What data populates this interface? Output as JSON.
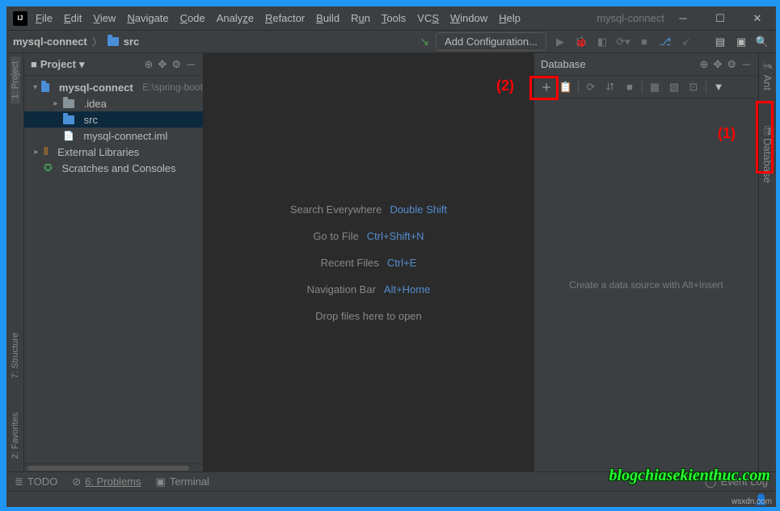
{
  "title": "mysql-connect",
  "menu": [
    "File",
    "Edit",
    "View",
    "Navigate",
    "Code",
    "Analyze",
    "Refactor",
    "Build",
    "Run",
    "Tools",
    "VCS",
    "Window",
    "Help"
  ],
  "breadcrumb": {
    "root": "mysql-connect",
    "child": "src"
  },
  "addConfig": "Add Configuration...",
  "projectPanel": {
    "title": "Project",
    "tree": {
      "root": "mysql-connect",
      "rootPath": "E:\\spring-boot",
      "idea": ".idea",
      "src": "src",
      "iml": "mysql-connect.iml",
      "libs": "External Libraries",
      "scratch": "Scratches and Consoles"
    }
  },
  "tips": [
    {
      "act": "Search Everywhere",
      "key": "Double Shift"
    },
    {
      "act": "Go to File",
      "key": "Ctrl+Shift+N"
    },
    {
      "act": "Recent Files",
      "key": "Ctrl+E"
    },
    {
      "act": "Navigation Bar",
      "key": "Alt+Home"
    },
    {
      "act": "Drop files here to open",
      "key": ""
    }
  ],
  "database": {
    "title": "Database",
    "hint": "Create a data source with Alt+Insert"
  },
  "leftGutter": [
    "1: Project",
    "7: Structure",
    "2: Favorites"
  ],
  "rightGutter": [
    "Ant",
    "Database"
  ],
  "bottom": {
    "todo": "TODO",
    "problems": "6: Problems",
    "terminal": "Terminal",
    "eventlog": "Event Log"
  },
  "annotations": {
    "a1": "(1)",
    "a2": "(2)"
  },
  "watermark": "blogchiasekienthuc.com",
  "wsx": "wsxdn.com"
}
